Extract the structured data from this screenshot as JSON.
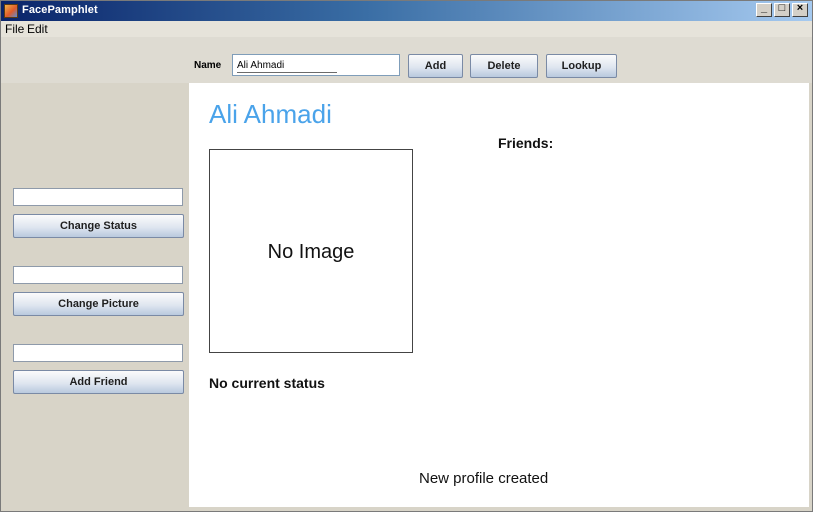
{
  "window": {
    "title": "FacePamphlet",
    "controls": [
      "_",
      "□",
      "×"
    ]
  },
  "menu": {
    "items": [
      "File",
      "Edit"
    ]
  },
  "toolbar": {
    "name_label": "Name",
    "name_value": "Ali Ahmadi",
    "add_label": "Add",
    "delete_label": "Delete",
    "lookup_label": "Lookup"
  },
  "sidebar": {
    "status_input": "",
    "change_status_label": "Change Status",
    "picture_input": "",
    "change_picture_label": "Change Picture",
    "friend_input": "",
    "add_friend_label": "Add Friend"
  },
  "profile": {
    "name": "Ali Ahmadi",
    "image_placeholder": "No Image",
    "status": "No current status",
    "friends_label": "Friends:",
    "message": "New profile created"
  },
  "colors": {
    "profile_name": "#4aa3ea",
    "title_bar": "#0a246a"
  },
  "icons": {
    "app": "app-icon",
    "minimize": "minimize-icon",
    "maximize": "maximize-icon",
    "close": "close-icon"
  }
}
